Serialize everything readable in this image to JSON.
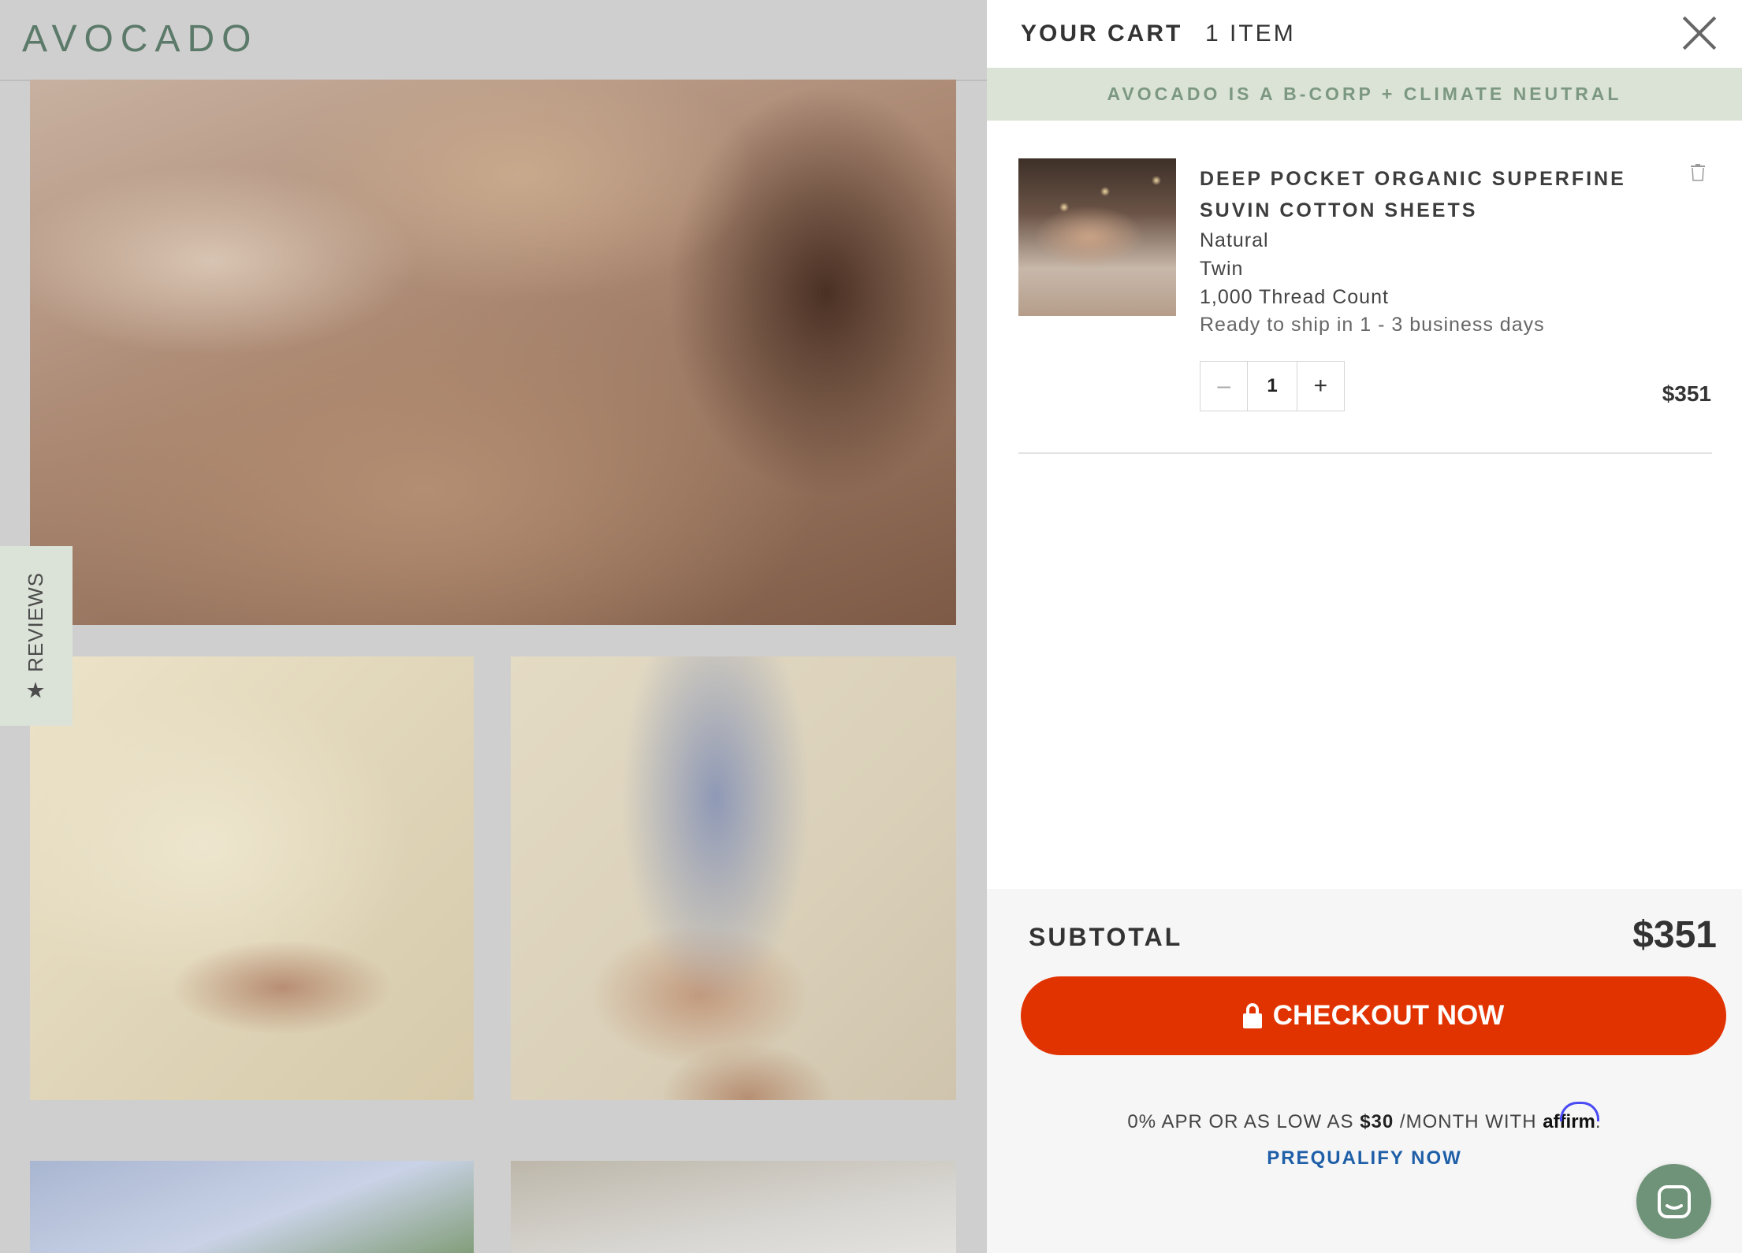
{
  "site": {
    "logo": "AVOCADO",
    "reviews_tab": "REVIEWS"
  },
  "cart": {
    "title": "YOUR CART",
    "count": "1 ITEM",
    "banner": "AVOCADO IS A B-CORP + CLIMATE NEUTRAL",
    "item": {
      "name": "DEEP POCKET ORGANIC SUPERFINE SUVIN COTTON SHEETS",
      "color": "Natural",
      "size": "Twin",
      "thread_count": "1,000 Thread Count",
      "shipping": "Ready to ship in 1 - 3 business days",
      "quantity": "1",
      "price": "$351",
      "minus": "–",
      "plus": "+"
    },
    "footer": {
      "subtotal_label": "SUBTOTAL",
      "subtotal_value": "$351",
      "checkout_label": "CHECKOUT NOW",
      "affirm_prefix": "0% APR OR AS LOW AS ",
      "affirm_amount": "$30",
      "affirm_suffix": " /MONTH WITH ",
      "affirm_brand": "affirm",
      "prequalify": "PREQUALIFY NOW"
    }
  },
  "colors": {
    "accent": "#e13300",
    "brand_green": "#5c7a6a",
    "banner_bg": "#dae3d6",
    "link_blue": "#1f5fa8"
  },
  "icons": [
    "close-icon",
    "trash-icon",
    "lock-icon",
    "star-icon",
    "chat-icon"
  ]
}
